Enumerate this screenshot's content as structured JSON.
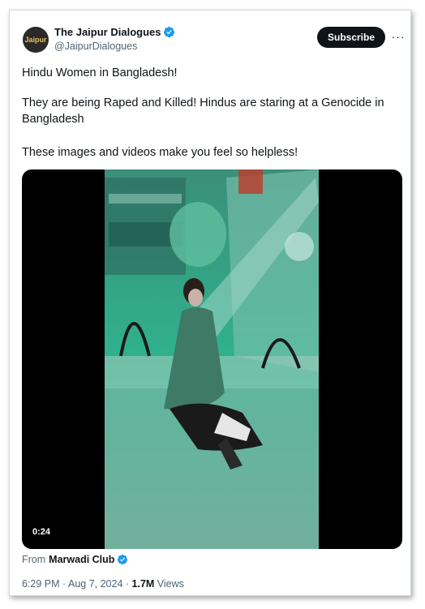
{
  "account": {
    "display_name": "The Jaipur Dialogues",
    "handle": "@JaipurDialogues",
    "avatar_text": "Jaipur",
    "verified_color": "#1d9bf0"
  },
  "actions": {
    "subscribe_label": "Subscribe",
    "more_label": "···"
  },
  "tweet": {
    "line1": "Hindu Women in Bangladesh!",
    "line2": "They are being Raped and Killed! Hindus are staring at a Genocide in Bangladesh",
    "line3": "These images and videos make you feel so helpless!"
  },
  "media": {
    "duration": "0:24",
    "type": "video"
  },
  "source": {
    "prefix": "From",
    "name": "Marwadi Club"
  },
  "meta": {
    "time": "6:29 PM",
    "separator": " · ",
    "date": "Aug 7, 2024",
    "views_count": "1.7M",
    "views_label": " Views"
  },
  "colors": {
    "text_primary": "#0f1419",
    "text_secondary": "#536471",
    "accent": "#1d9bf0",
    "border": "#cfd9de"
  }
}
